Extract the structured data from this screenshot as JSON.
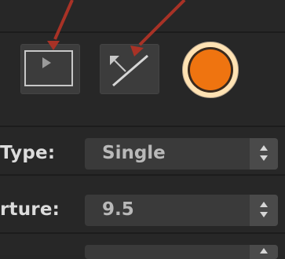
{
  "toolbar": {
    "play_icon": "play-icon",
    "line_icon": "diagonal-line-tool-icon",
    "record_color": "#ef7410"
  },
  "rows": [
    {
      "label": "Type:",
      "value": "Single"
    },
    {
      "label": "rture:",
      "value": "9.5"
    },
    {
      "label": "",
      "value": ""
    }
  ],
  "annotation_color": "#a83226"
}
